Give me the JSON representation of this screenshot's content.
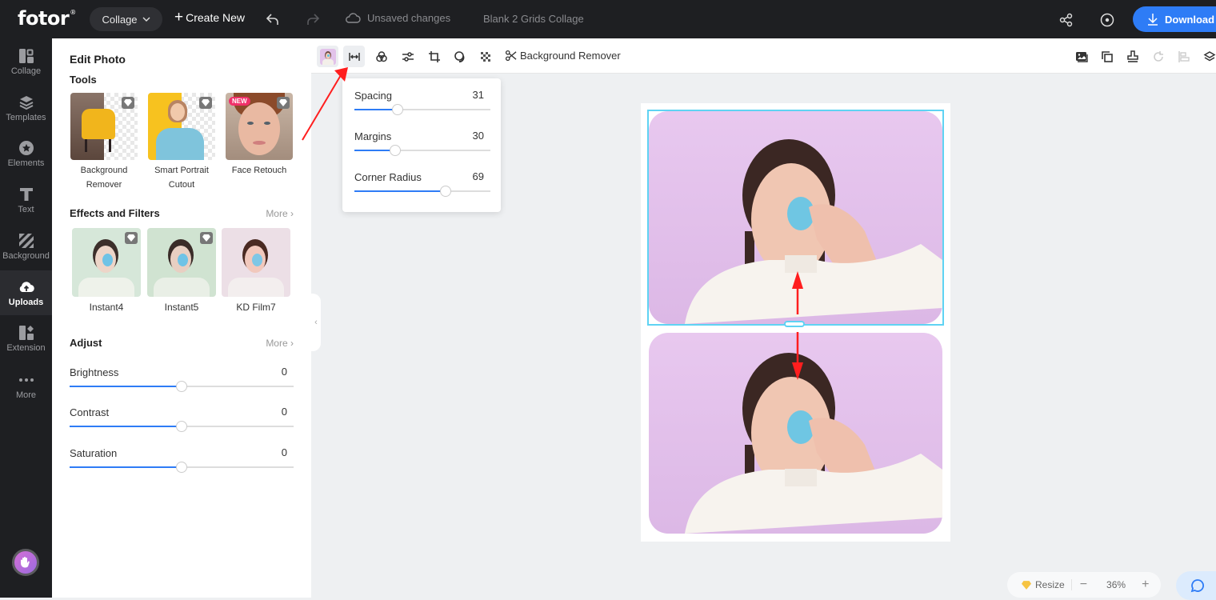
{
  "header": {
    "logo": "fotor",
    "logo_mark": "®",
    "mode_select": "Collage",
    "create_new": "Create New",
    "save_status": "Unsaved changes",
    "document_title": "Blank 2 Grids Collage",
    "download_label": "Download",
    "accent_color": "#2e7cf6"
  },
  "sidenav": {
    "items": [
      {
        "label": "Collage",
        "icon": "collage-icon"
      },
      {
        "label": "Templates",
        "icon": "layers-icon"
      },
      {
        "label": "Elements",
        "icon": "star-icon"
      },
      {
        "label": "Text",
        "icon": "text-icon"
      },
      {
        "label": "Background",
        "icon": "stripes-icon"
      },
      {
        "label": "Uploads",
        "icon": "upload-cloud-icon",
        "active": true
      },
      {
        "label": "Extension",
        "icon": "extension-icon"
      },
      {
        "label": "More",
        "icon": "more-dots-icon"
      }
    ]
  },
  "panel": {
    "title": "Edit Photo",
    "tools_heading": "Tools",
    "tools": [
      {
        "label": "Background Remover",
        "premium": true
      },
      {
        "label": "Smart Portrait Cutout",
        "premium": true
      },
      {
        "label": "Face Retouch",
        "premium": true,
        "badge": "NEW"
      }
    ],
    "effects_heading": "Effects and Filters",
    "effects_more": "More",
    "effects": [
      {
        "label": "Instant4",
        "premium": true
      },
      {
        "label": "Instant5",
        "premium": true
      },
      {
        "label": "KD Film7",
        "premium": false
      }
    ],
    "adjust_heading": "Adjust",
    "adjust_more": "More",
    "adjust": [
      {
        "label": "Brightness",
        "value": "0",
        "fraction": 0.5
      },
      {
        "label": "Contrast",
        "value": "0",
        "fraction": 0.5
      },
      {
        "label": "Saturation",
        "value": "0",
        "fraction": 0.5
      }
    ]
  },
  "toolbar": {
    "background_remover": "Background Remover"
  },
  "spacing_popup": {
    "sliders": [
      {
        "label": "Spacing",
        "value": "31",
        "fraction": 0.32
      },
      {
        "label": "Margins",
        "value": "30",
        "fraction": 0.3
      },
      {
        "label": "Corner Radius",
        "value": "69",
        "fraction": 0.67
      }
    ]
  },
  "footer": {
    "resize": "Resize",
    "zoom": "36%"
  }
}
